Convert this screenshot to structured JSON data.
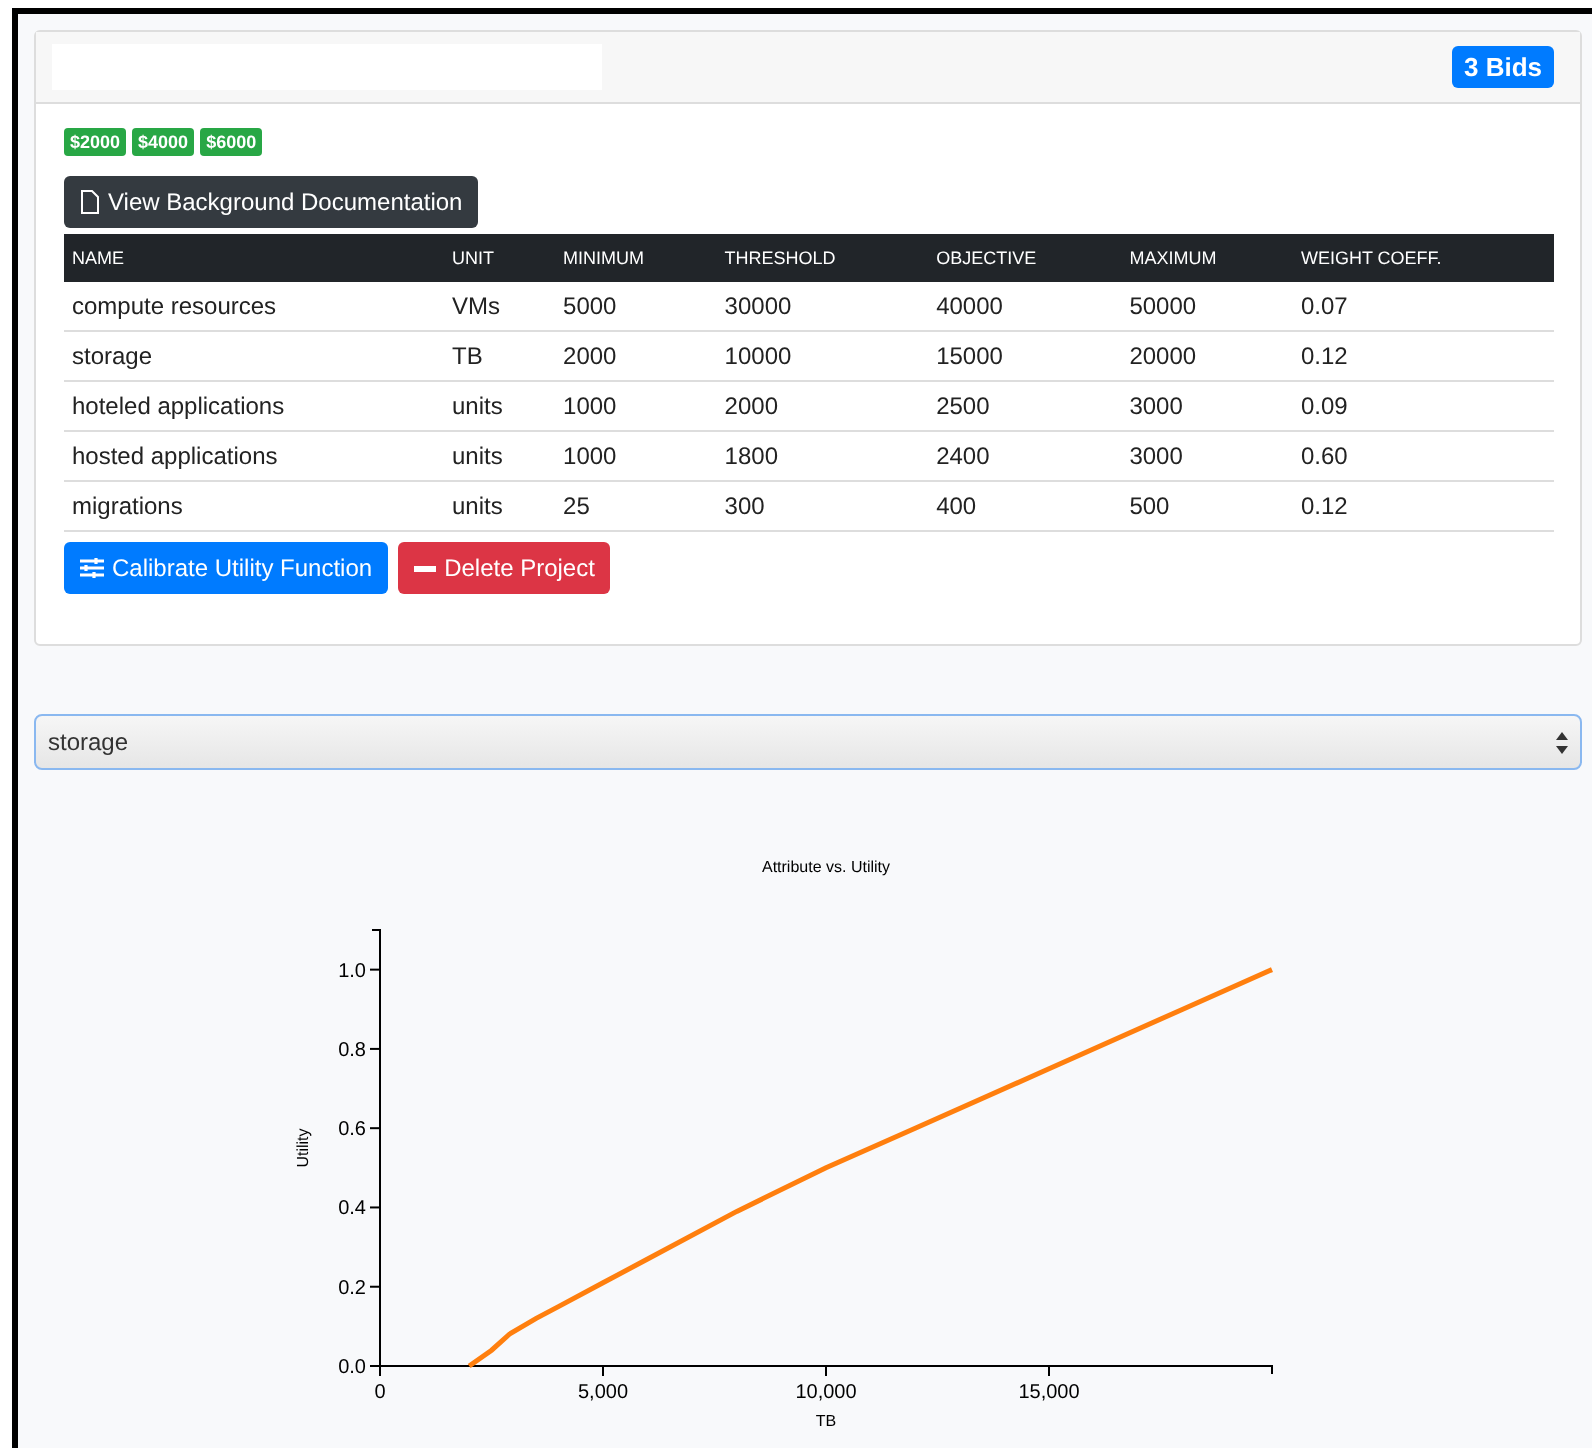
{
  "card": {
    "bids_badge": "3 Bids",
    "prices": [
      "$2000",
      "$4000",
      "$6000"
    ],
    "doc_button": "View Background Documentation",
    "table": {
      "columns": [
        "NAME",
        "UNIT",
        "MINIMUM",
        "THRESHOLD",
        "OBJECTIVE",
        "MAXIMUM",
        "WEIGHT COEFF."
      ],
      "rows": [
        [
          "compute resources",
          "VMs",
          "5000",
          "30000",
          "40000",
          "50000",
          "0.07"
        ],
        [
          "storage",
          "TB",
          "2000",
          "10000",
          "15000",
          "20000",
          "0.12"
        ],
        [
          "hoteled applications",
          "units",
          "1000",
          "2000",
          "2500",
          "3000",
          "0.09"
        ],
        [
          "hosted applications",
          "units",
          "1000",
          "1800",
          "2400",
          "3000",
          "0.60"
        ],
        [
          "migrations",
          "units",
          "25",
          "300",
          "400",
          "500",
          "0.12"
        ]
      ]
    },
    "buttons": [
      {
        "kind": "calibrate",
        "label": "Calibrate Utility Function"
      },
      {
        "kind": "delete",
        "label": "Delete Project"
      }
    ]
  },
  "attribute_select": {
    "value": "storage"
  },
  "chart": {
    "chart_data": {
      "type": "line",
      "title": "Attribute vs. Utility",
      "xlabel": "TB",
      "ylabel": "Utility",
      "x": [
        2000,
        2500,
        2900,
        3500,
        4000,
        5000,
        6000,
        8000,
        10000,
        12000,
        15000,
        18000,
        20000
      ],
      "series": [
        {
          "color": "#ff7f0e",
          "values": [
            0,
            0.04,
            0.08,
            0.12,
            0.15,
            0.21,
            0.27,
            0.39,
            0.5,
            0.6,
            0.75,
            0.9,
            1.0
          ]
        }
      ],
      "xlim": [
        0,
        20000
      ],
      "ylim": [
        0,
        1.1
      ],
      "xticks": [
        {
          "value": 0,
          "label": "0"
        },
        {
          "value": 5000,
          "label": "5,000"
        },
        {
          "value": 10000,
          "label": "10,000"
        },
        {
          "value": 15000,
          "label": "15,000"
        }
      ],
      "yticks": [
        {
          "value": 0,
          "label": "0.0"
        },
        {
          "value": 0.2,
          "label": "0.2"
        },
        {
          "value": 0.4,
          "label": "0.4"
        },
        {
          "value": 0.6,
          "label": "0.6"
        },
        {
          "value": 0.8,
          "label": "0.8"
        },
        {
          "value": 1,
          "label": "1.0"
        }
      ]
    }
  }
}
